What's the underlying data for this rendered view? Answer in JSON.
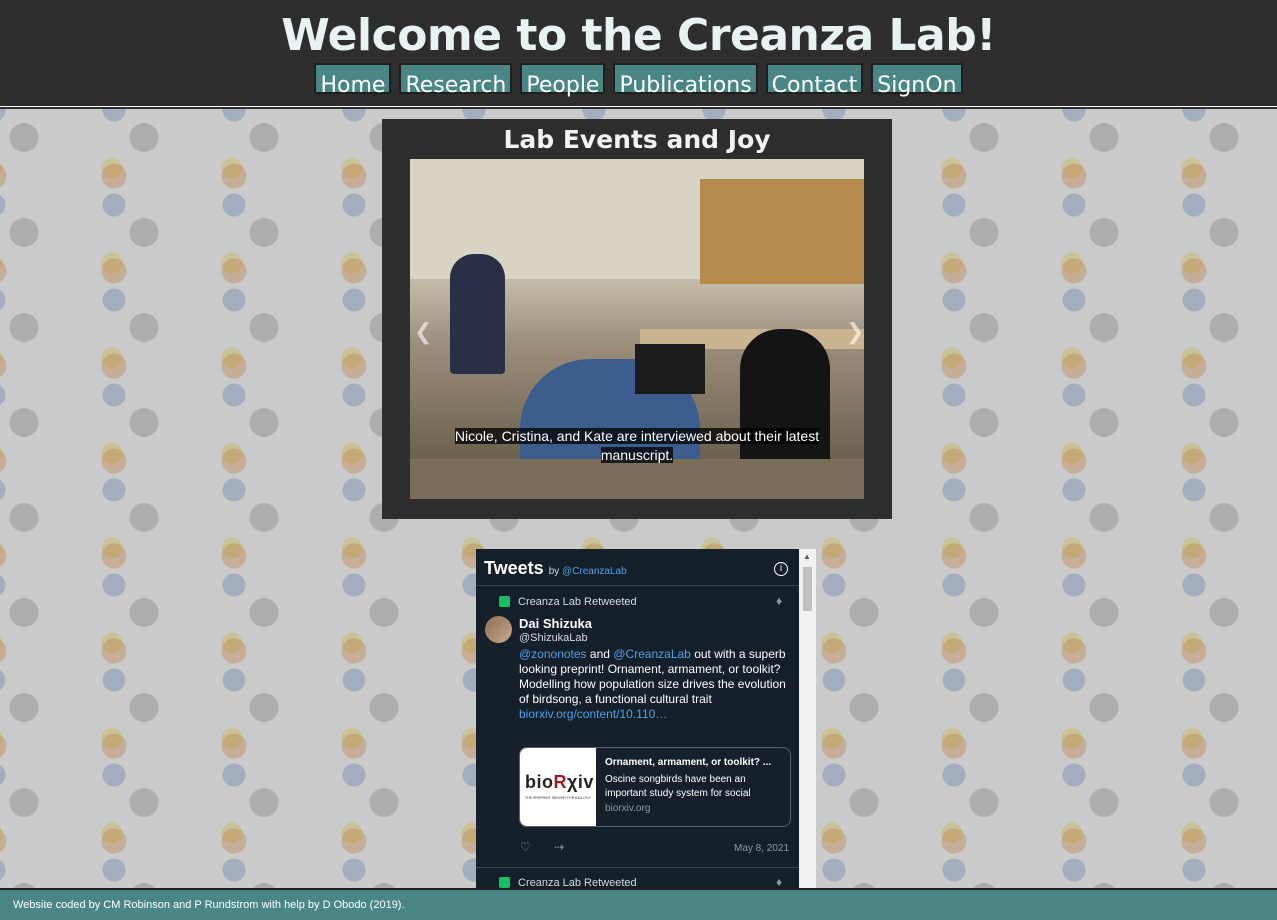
{
  "site": {
    "title": "Welcome to the Creanza Lab!"
  },
  "nav": {
    "items": [
      "Home",
      "Research",
      "People",
      "Publications",
      "Contact",
      "SignOn"
    ]
  },
  "events": {
    "title": "Lab Events and Joy",
    "caption": "Nicole, Cristina, and Kate are interviewed about their latest manuscript.",
    "prev_icon": "chevron-left-icon",
    "next_icon": "chevron-right-icon"
  },
  "tweets": {
    "title": "Tweets",
    "by": "by",
    "handle": "@CreanzaLab",
    "retweeted_label": "Creanza Lab Retweeted",
    "tweet": {
      "author": "Dai Shizuka",
      "author_handle": "@ShizukaLab",
      "mention1": "@zononotes",
      "and": "and",
      "mention2": "@CreanzaLab",
      "text": "out with a superb looking preprint! Ornament, armament, or toolkit? Modelling how population size drives the evolution of birdsong, a functional cultural trait",
      "link": "biorxiv.org/content/10.110…",
      "card": {
        "logo_prefix": "bio",
        "logo_r": "R",
        "logo_suffix": "χiv",
        "logo_tagline": "THE PREPRINT SERVER FOR BIOLOGY",
        "title": "Ornament, armament, or toolkit? ...",
        "description": "Oscine songbirds have been an important study system for social",
        "domain": "biorxiv.org"
      },
      "date": "May 8, 2021"
    },
    "second_retweeted_label": "Creanza Lab Retweeted"
  },
  "footer": {
    "text": "Website coded by CM Robinson and P Rundstrom with help by D Obodo (2019)."
  },
  "colors": {
    "header_bg": "#2e2e2e",
    "accent": "#4a8686",
    "twitter_bg": "#15202b",
    "link": "#4ea1e8"
  }
}
